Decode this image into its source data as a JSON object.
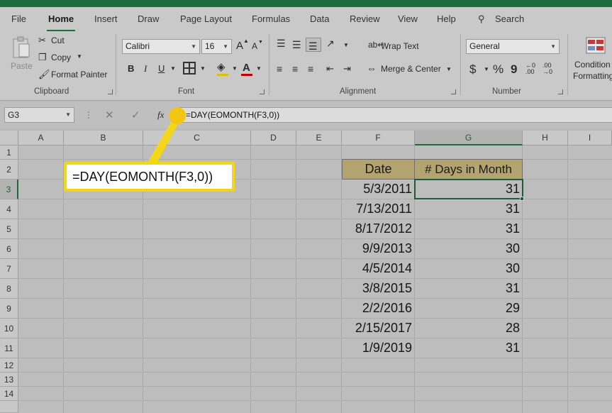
{
  "ribbon_tabs": [
    "File",
    "Home",
    "Insert",
    "Draw",
    "Page Layout",
    "Formulas",
    "Data",
    "Review",
    "View",
    "Help"
  ],
  "search_label": "Search",
  "clipboard": {
    "paste": "Paste",
    "cut": "Cut",
    "copy": "Copy",
    "format_painter": "Format Painter",
    "group": "Clipboard"
  },
  "font": {
    "name": "Calibri",
    "size": "16",
    "bold": "B",
    "italic": "I",
    "underline": "U",
    "grow": "A",
    "shrink": "A",
    "group": "Font"
  },
  "alignment": {
    "wrap_text": "Wrap Text",
    "merge_center": "Merge & Center",
    "group": "Alignment"
  },
  "number": {
    "format": "General",
    "currency": "$",
    "percent": "%",
    "comma": "9",
    "group": "Number"
  },
  "styles": {
    "conditional_1": "Condition",
    "conditional_2": "Formatting"
  },
  "formula_bar": {
    "name_box": "G3",
    "fx": "fx",
    "formula": "=DAY(EOMONTH(F3,0))"
  },
  "columns": [
    "A",
    "B",
    "C",
    "D",
    "E",
    "F",
    "G",
    "H",
    "I"
  ],
  "rows": [
    "1",
    "2",
    "3",
    "4",
    "5",
    "6",
    "7",
    "8",
    "9",
    "10",
    "11",
    "12",
    "13",
    "14"
  ],
  "table": {
    "header_date": "Date",
    "header_days": "# Days in Month",
    "dates": [
      "5/3/2011",
      "7/13/2011",
      "8/17/2012",
      "9/9/2013",
      "4/5/2014",
      "3/8/2015",
      "2/2/2016",
      "2/15/2017",
      "1/9/2019"
    ],
    "days": [
      "31",
      "31",
      "31",
      "30",
      "30",
      "31",
      "29",
      "28",
      "31"
    ]
  },
  "callout_text": "=DAY(EOMONTH(F3,0))",
  "colors": {
    "excel_green": "#1d6b3e",
    "callout_yellow": "#f3d51a",
    "header_fill": "#b3a46f"
  }
}
